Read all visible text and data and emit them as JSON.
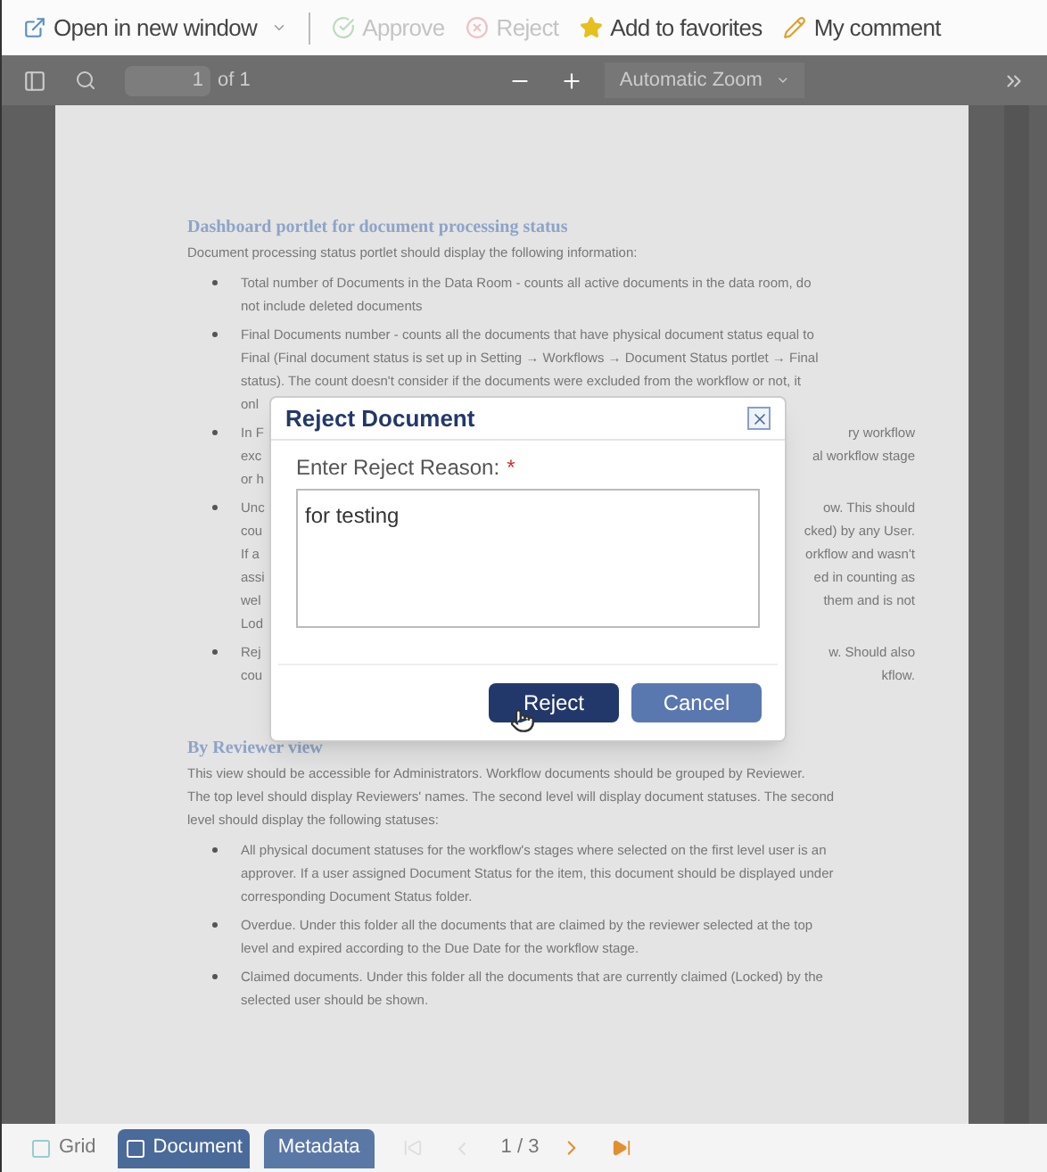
{
  "toolbar": [
    {
      "label": "Open in new window",
      "disabled": false,
      "dropdown": true
    },
    {
      "label": "Approve",
      "disabled": true,
      "dropdown": false
    },
    {
      "label": "Reject",
      "disabled": true,
      "dropdown": false
    },
    {
      "label": "Add to favorites",
      "disabled": false,
      "dropdown": false
    },
    {
      "label": "My comment",
      "disabled": false,
      "dropdown": false
    }
  ],
  "viewer_toolbar": {
    "page": "1",
    "page_count": "of 1",
    "zoom": "Automatic Zoom"
  },
  "document": {
    "sections": [
      {
        "heading": "Dashboard portlet for document processing status",
        "intro": [
          "Document processing status portlet should display the following information:"
        ],
        "bullets": [
          [
            {
              "kind": "full",
              "text": "Total number of Documents in the Data Room - counts all active documents in the data room, do"
            },
            {
              "kind": "full",
              "text": "not include deleted documents"
            }
          ],
          [
            {
              "kind": "full",
              "text": "Final Documents number - counts all the documents that have physical document status equal to"
            },
            {
              "kind": "full",
              "text": "Final (Final document status is set up in Setting → Workflows → Document Status portlet → Final"
            },
            {
              "kind": "full",
              "text": "status). The count doesn't consider if the documents were excluded from the workflow or not, it"
            },
            {
              "kind": "split",
              "left": "onl"
            }
          ],
          [
            {
              "kind": "split",
              "left": "In F",
              "right": "ry workflow"
            },
            {
              "kind": "split",
              "left": "exc",
              "right": "al workflow stage"
            },
            {
              "kind": "split",
              "left": "or h"
            }
          ],
          [
            {
              "kind": "split",
              "left": "Unc",
              "right": "ow. This should"
            },
            {
              "kind": "split",
              "left": "cou",
              "right": "cked) by any User."
            },
            {
              "kind": "split",
              "left": "If a",
              "right": "orkflow and wasn't"
            },
            {
              "kind": "split",
              "left": "assi",
              "right": "ed in counting as"
            },
            {
              "kind": "split",
              "left": "wel",
              "right": "them and is not"
            },
            {
              "kind": "split",
              "left": "Lod"
            }
          ],
          [
            {
              "kind": "split",
              "left": "Rej",
              "right": "w. Should also"
            },
            {
              "kind": "split",
              "left": "cou",
              "right": "kflow."
            }
          ]
        ]
      },
      {
        "heading": "By Reviewer view",
        "intro": [
          "This view should be accessible for Administrators. Workflow documents should be grouped by Reviewer.",
          "The top level should display Reviewers' names. The second level will display document statuses. The second",
          "level should display the following statuses:"
        ],
        "bullets": [
          [
            {
              "kind": "full",
              "text": "All physical document statuses for the workflow's stages where selected on the first level user is an"
            },
            {
              "kind": "full",
              "text": "approver.  If a user assigned Document Status for the item, this document should be displayed under"
            },
            {
              "kind": "full",
              "text": "corresponding Document Status folder."
            }
          ],
          [
            {
              "kind": "full",
              "text": "Overdue. Under this folder all the documents that are claimed by the reviewer selected at the top"
            },
            {
              "kind": "full",
              "text": "level and expired according to the Due Date for the workflow stage."
            }
          ],
          [
            {
              "kind": "full",
              "text": "Claimed documents. Under this folder all the documents that are currently claimed (Locked) by the"
            },
            {
              "kind": "full",
              "text": "selected user should be shown."
            }
          ]
        ]
      }
    ]
  },
  "dialog": {
    "title": "Reject Document",
    "label": "Enter Reject Reason:",
    "required_mark": "*",
    "value": "for testing",
    "buttons": [
      {
        "label": "Reject",
        "kind": "primary"
      },
      {
        "label": "Cancel",
        "kind": "secondary"
      }
    ]
  },
  "bottom_bar": {
    "tabs": [
      {
        "label": "Grid",
        "selected": false
      },
      {
        "label": "Document",
        "selected": true
      }
    ],
    "metadata": "Metadata",
    "pager": "1 / 3",
    "first_disabled": true,
    "prev_disabled": true
  }
}
